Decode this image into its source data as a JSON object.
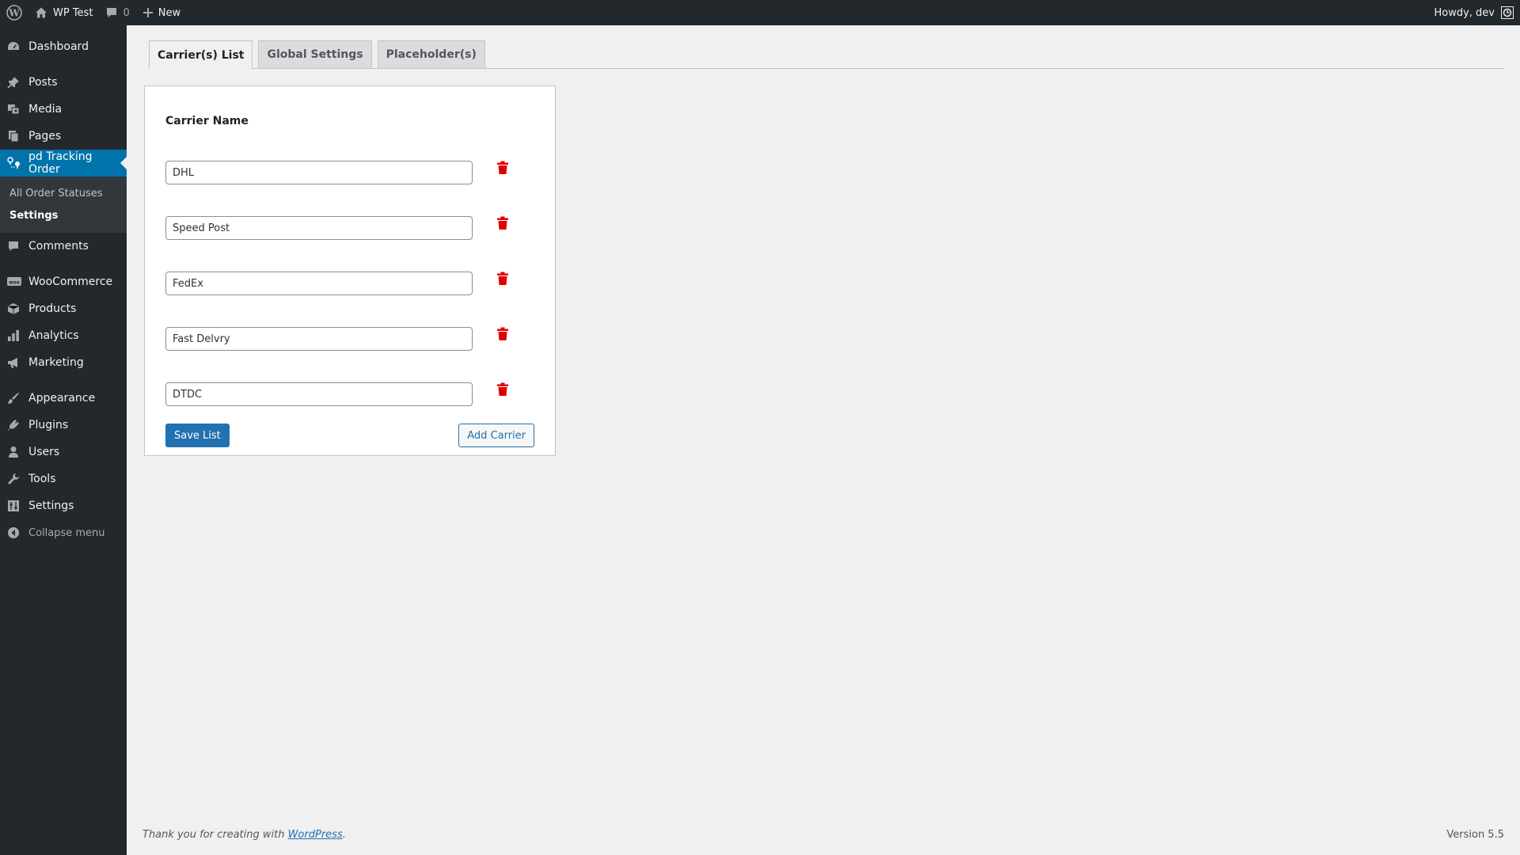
{
  "adminbar": {
    "site_name": "WP Test",
    "comments_count": "0",
    "new_label": "New",
    "howdy": "Howdy, dev"
  },
  "sidebar": {
    "items": [
      {
        "label": "Dashboard",
        "icon": "dashboard-icon"
      },
      {
        "label": "Posts",
        "icon": "pin-icon"
      },
      {
        "label": "Media",
        "icon": "media-icon"
      },
      {
        "label": "Pages",
        "icon": "pages-icon"
      },
      {
        "label": "pd Tracking Order",
        "icon": "location-icon"
      },
      {
        "label": "Comments",
        "icon": "comment-icon"
      },
      {
        "label": "WooCommerce",
        "icon": "woo-icon"
      },
      {
        "label": "Products",
        "icon": "box-icon"
      },
      {
        "label": "Analytics",
        "icon": "bar-chart-icon"
      },
      {
        "label": "Marketing",
        "icon": "megaphone-icon"
      },
      {
        "label": "Appearance",
        "icon": "brush-icon"
      },
      {
        "label": "Plugins",
        "icon": "plug-icon"
      },
      {
        "label": "Users",
        "icon": "user-icon"
      },
      {
        "label": "Tools",
        "icon": "wrench-icon"
      },
      {
        "label": "Settings",
        "icon": "sliders-icon"
      }
    ],
    "submenu": [
      "All Order Statuses",
      "Settings"
    ],
    "collapse_label": "Collapse menu"
  },
  "tabs": [
    "Carrier(s) List",
    "Global Settings",
    "Placeholder(s)"
  ],
  "panel": {
    "heading": "Carrier Name",
    "carriers": [
      "DHL",
      "Speed Post",
      "FedEx",
      "Fast Delvry",
      "DTDC"
    ],
    "save_label": "Save List",
    "add_label": "Add Carrier"
  },
  "footer": {
    "thank_you_prefix": "Thank you for creating with ",
    "wordpress_link": "WordPress",
    "thank_you_suffix": ".",
    "version": "Version 5.5"
  },
  "colors": {
    "adminbar_bg": "#23282d",
    "sidebar_bg": "#23282d",
    "current_menu": "#0073aa",
    "primary_button": "#2271b1",
    "trash_icon": "#e00000",
    "page_bg": "#f0f0f1"
  }
}
